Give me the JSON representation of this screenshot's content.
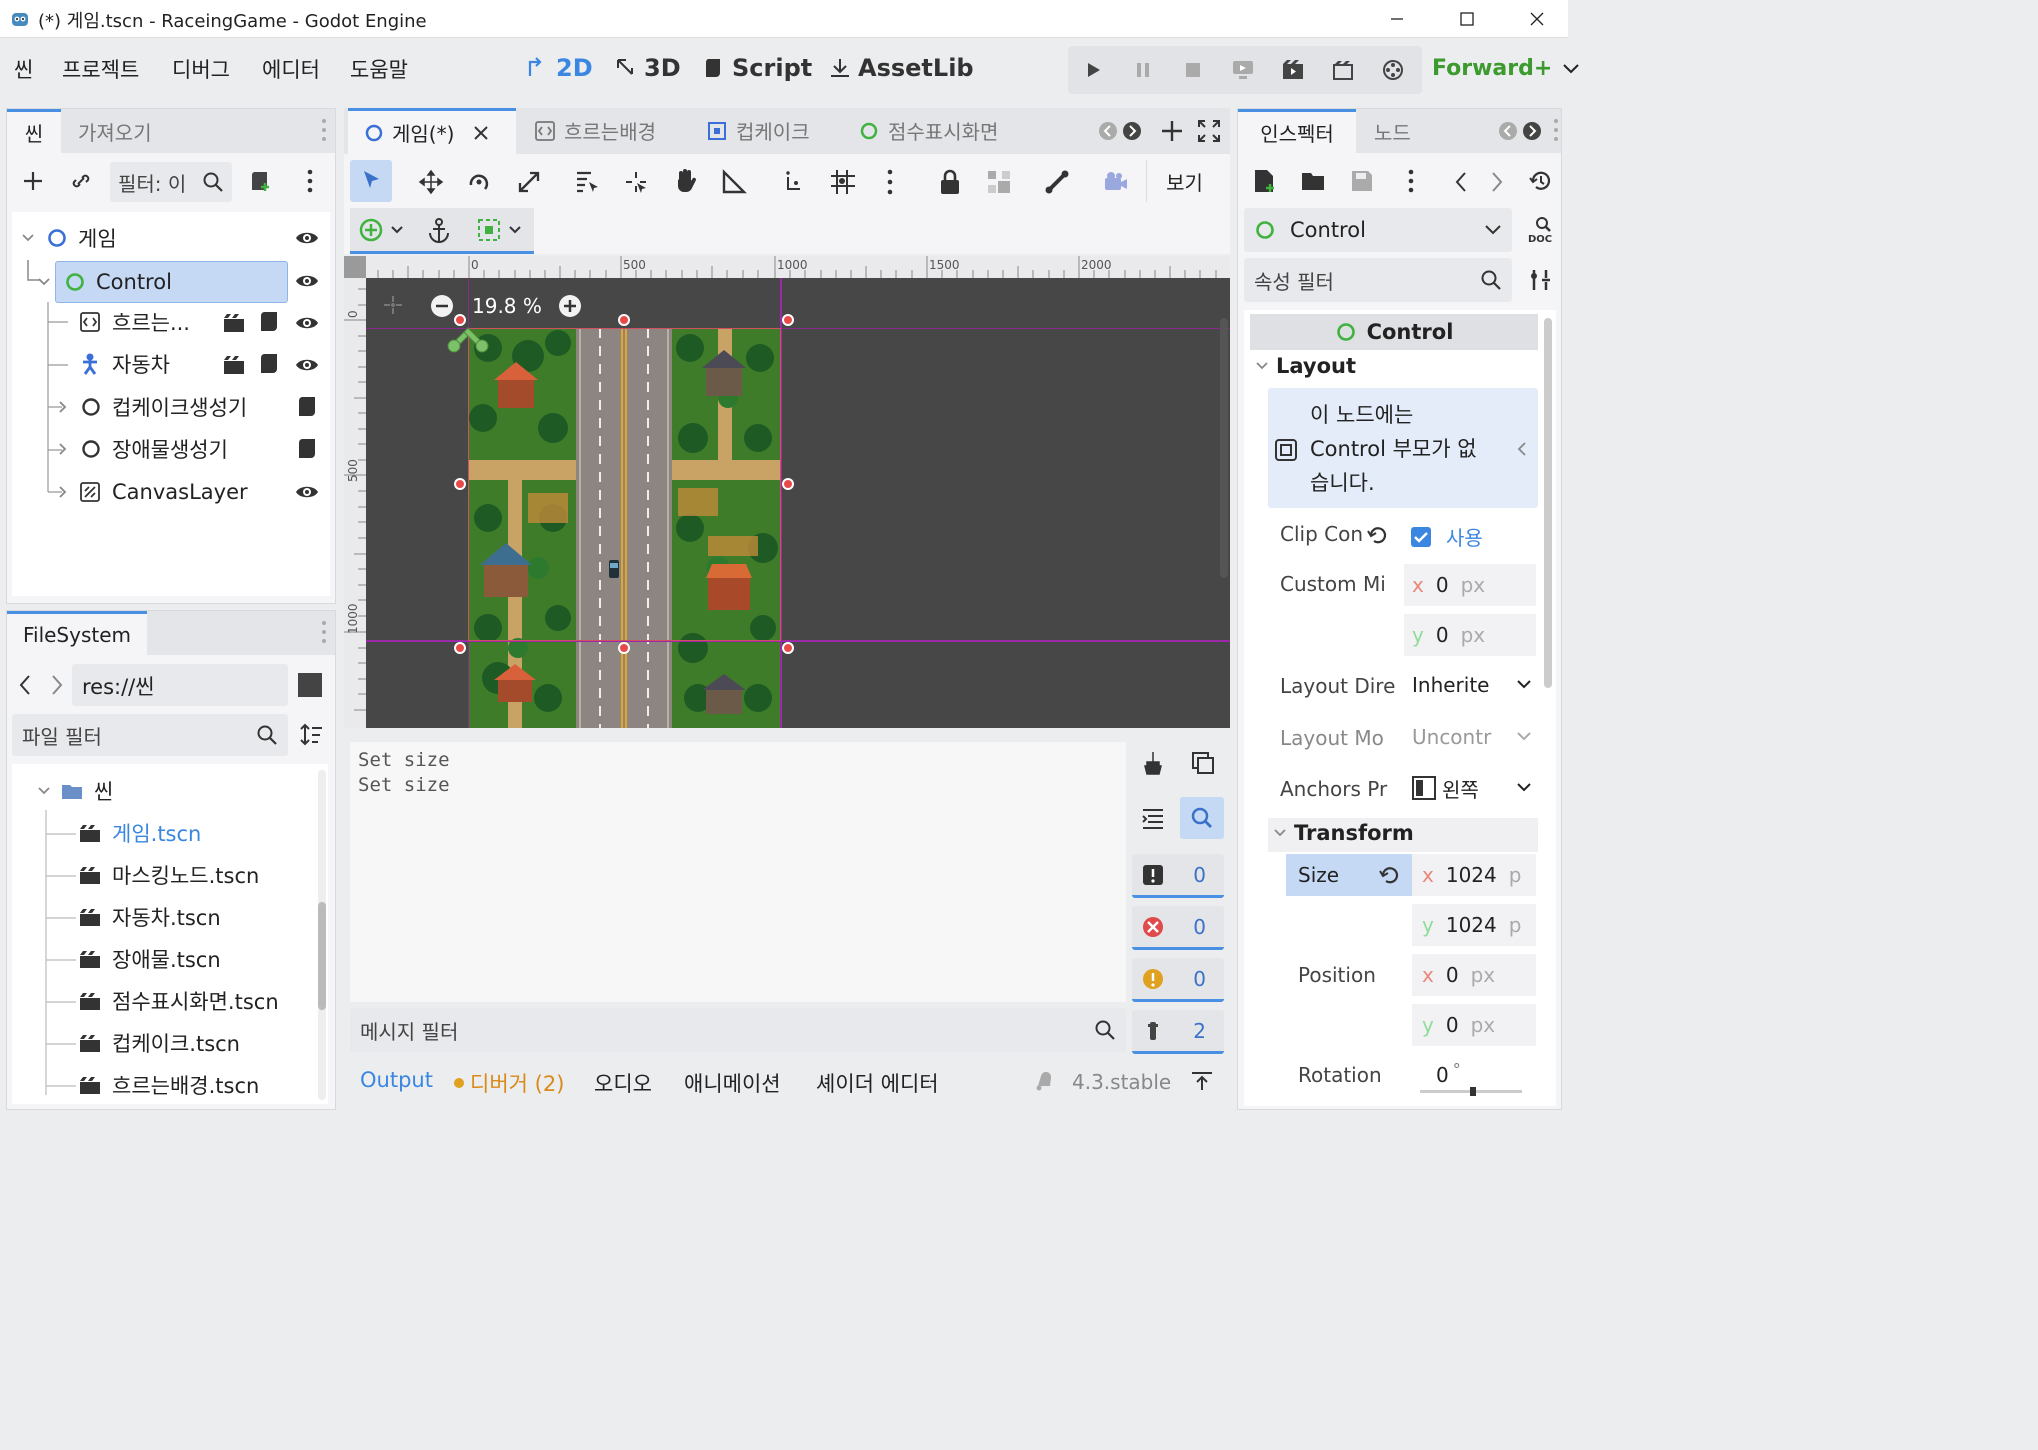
{
  "window": {
    "title": "(*) 게임.tscn - RaceingGame - Godot Engine"
  },
  "menu": {
    "items": [
      "씬",
      "프로젝트",
      "디버그",
      "에디터",
      "도움말"
    ],
    "workspaces": [
      "2D",
      "3D",
      "Script",
      "AssetLib"
    ],
    "renderer": "Forward+"
  },
  "scene_panel": {
    "tabs": [
      "씬",
      "가져오기"
    ],
    "filter_placeholder": "필터: 이",
    "tree": [
      {
        "label": "게임",
        "level": 0
      },
      {
        "label": "Control",
        "level": 1,
        "selected": true
      },
      {
        "label": "흐르는...",
        "level": 2
      },
      {
        "label": "자동차",
        "level": 2
      },
      {
        "label": "컵케이크생성기",
        "level": 2
      },
      {
        "label": "장애물생성기",
        "level": 2
      },
      {
        "label": "CanvasLayer",
        "level": 2
      }
    ]
  },
  "filesystem": {
    "tab": "FileSystem",
    "path": "res://씬",
    "filter_placeholder": "파일 필터",
    "folder": "씬",
    "files": [
      "게임.tscn",
      "마스킹노드.tscn",
      "자동차.tscn",
      "장애물.tscn",
      "점수표시화면.tscn",
      "컵케이크.tscn",
      "흐르는배경.tscn"
    ],
    "active_file": "게임.tscn"
  },
  "editor_tabs": [
    "게임(*)",
    "흐르는배경",
    "컵케이크",
    "점수표시화면"
  ],
  "toolbar": {
    "view_label": "보기"
  },
  "viewport": {
    "zoom": "19.8 %",
    "ruler_x": [
      "0",
      "500",
      "1000",
      "1500",
      "2000"
    ],
    "ruler_y": [
      "0",
      "500",
      "1000"
    ]
  },
  "output": {
    "lines": [
      "Set size",
      "Set size"
    ],
    "filter_placeholder": "메시지 필터",
    "counters": [
      "0",
      "0",
      "0",
      "2"
    ],
    "bottom_tabs": [
      "Output",
      "디버거 (2)",
      "오디오",
      "애니메이션",
      "셰이더 에디터"
    ],
    "version": "4.3.stable"
  },
  "inspector": {
    "tabs": [
      "인스펙터",
      "노드"
    ],
    "node_type": "Control",
    "filter_placeholder": "속성 필터",
    "header": "Control",
    "section_layout": "Layout",
    "warning": [
      "이 노드에는",
      "Control 부모가 없",
      "습니다."
    ],
    "clip_label": "Clip Con",
    "clip_value": "사용",
    "custom_min_label": "Custom Mi",
    "custom_min_x": "0",
    "custom_min_y": "0",
    "unit_px": "px",
    "layout_dir_label": "Layout Dire",
    "layout_dir_value": "Inherite",
    "layout_mode_label": "Layout Mo",
    "layout_mode_value": "Uncontr",
    "anchors_label": "Anchors Pr",
    "anchors_value": "왼쪽",
    "section_transform": "Transform",
    "size_label": "Size",
    "size_x": "1024",
    "size_y": "1024",
    "unit_p": "p",
    "position_label": "Position",
    "position_x": "0",
    "position_y": "0",
    "rotation_label": "Rotation",
    "rotation_value": "0",
    "degree": "°",
    "axis_x": "x",
    "axis_y": "y"
  },
  "colors": {
    "accent": "#4a90e2",
    "control_green": "#3fb23f",
    "node_blue": "#3a6fd8",
    "renderer_green": "#3c9a2e"
  }
}
